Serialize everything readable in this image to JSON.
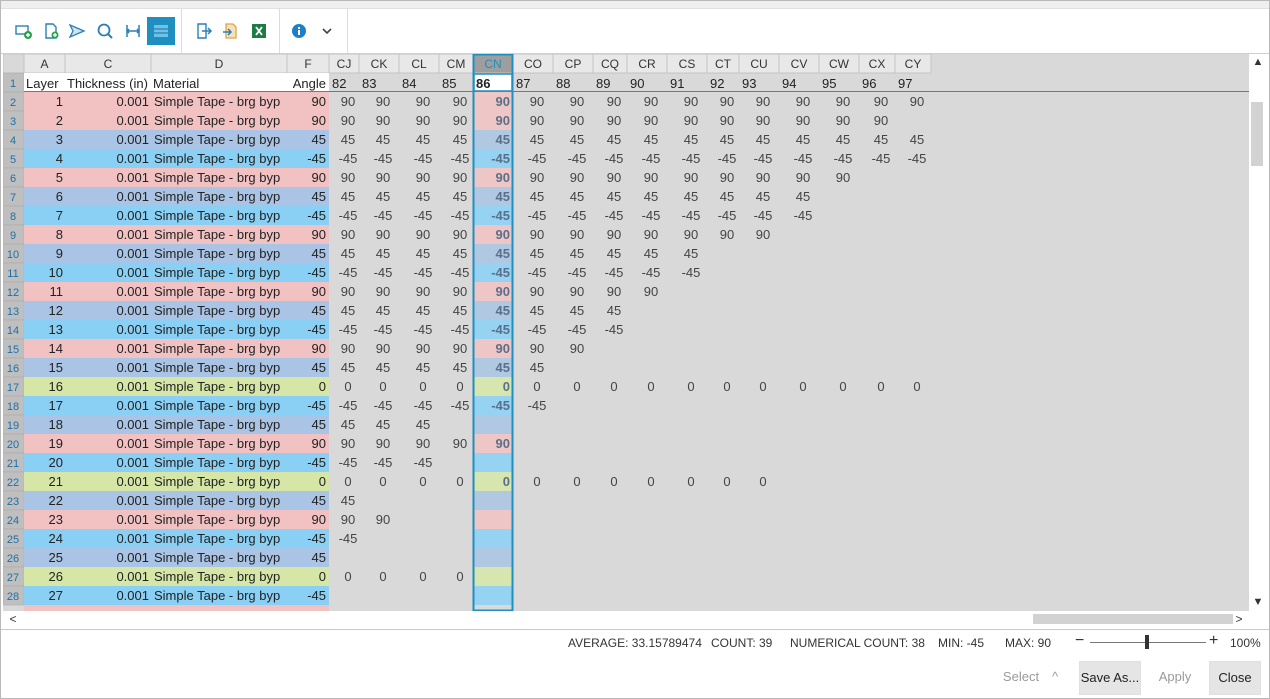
{
  "toolbar": {
    "buttons": [
      {
        "name": "add-row-icon"
      },
      {
        "name": "add-document-icon"
      },
      {
        "name": "send-icon"
      },
      {
        "name": "refresh-search-icon"
      },
      {
        "name": "fit-columns-icon"
      },
      {
        "name": "grid-view-icon"
      },
      {
        "name": "export-icon"
      },
      {
        "name": "import-icon"
      },
      {
        "name": "excel-icon"
      },
      {
        "name": "info-icon"
      },
      {
        "name": "chevron-down-icon"
      }
    ]
  },
  "grid": {
    "selected_column": "CN",
    "left_columns": [
      "A",
      "C",
      "D",
      "F"
    ],
    "left_headers": [
      "Layer",
      "Thickness (in)",
      "Material",
      "Angle"
    ],
    "extra_columns": [
      "CJ",
      "CK",
      "CL",
      "CM",
      "CN",
      "CO",
      "CP",
      "CQ",
      "CR",
      "CS",
      "CT",
      "CU",
      "CV",
      "CW",
      "CX",
      "CY"
    ],
    "extra_header_values": [
      "82",
      "83",
      "84",
      "85",
      "86",
      "87",
      "88",
      "89",
      "90",
      "91",
      "92",
      "93",
      "94",
      "95",
      "96",
      "97"
    ],
    "row_numbers": [
      "1",
      "2",
      "3",
      "4",
      "5",
      "6",
      "7",
      "8",
      "9",
      "10",
      "11",
      "12",
      "13",
      "14",
      "15",
      "16",
      "17",
      "18",
      "19",
      "20",
      "21",
      "22",
      "23",
      "24",
      "25",
      "26",
      "27",
      "28"
    ],
    "rows": [
      {
        "layer": "1",
        "thickness": "0.001",
        "material": "Simple Tape - brg byp",
        "angle": "90",
        "extra": [
          "90",
          "90",
          "90",
          "90",
          "90",
          "90",
          "90",
          "90",
          "90",
          "90",
          "90",
          "90",
          "90",
          "90",
          "90",
          "90"
        ]
      },
      {
        "layer": "2",
        "thickness": "0.001",
        "material": "Simple Tape - brg byp",
        "angle": "90",
        "extra": [
          "90",
          "90",
          "90",
          "90",
          "90",
          "90",
          "90",
          "90",
          "90",
          "90",
          "90",
          "90",
          "90",
          "90",
          "90",
          ""
        ]
      },
      {
        "layer": "3",
        "thickness": "0.001",
        "material": "Simple Tape - brg byp",
        "angle": "45",
        "extra": [
          "45",
          "45",
          "45",
          "45",
          "45",
          "45",
          "45",
          "45",
          "45",
          "45",
          "45",
          "45",
          "45",
          "45",
          "45",
          "45"
        ]
      },
      {
        "layer": "4",
        "thickness": "0.001",
        "material": "Simple Tape - brg byp",
        "angle": "-45",
        "extra": [
          "-45",
          "-45",
          "-45",
          "-45",
          "-45",
          "-45",
          "-45",
          "-45",
          "-45",
          "-45",
          "-45",
          "-45",
          "-45",
          "-45",
          "-45",
          "-45"
        ]
      },
      {
        "layer": "5",
        "thickness": "0.001",
        "material": "Simple Tape - brg byp",
        "angle": "90",
        "extra": [
          "90",
          "90",
          "90",
          "90",
          "90",
          "90",
          "90",
          "90",
          "90",
          "90",
          "90",
          "90",
          "90",
          "90",
          "",
          ""
        ]
      },
      {
        "layer": "6",
        "thickness": "0.001",
        "material": "Simple Tape - brg byp",
        "angle": "45",
        "extra": [
          "45",
          "45",
          "45",
          "45",
          "45",
          "45",
          "45",
          "45",
          "45",
          "45",
          "45",
          "45",
          "45",
          "",
          "",
          ""
        ]
      },
      {
        "layer": "7",
        "thickness": "0.001",
        "material": "Simple Tape - brg byp",
        "angle": "-45",
        "extra": [
          "-45",
          "-45",
          "-45",
          "-45",
          "-45",
          "-45",
          "-45",
          "-45",
          "-45",
          "-45",
          "-45",
          "-45",
          "-45",
          "",
          "",
          ""
        ]
      },
      {
        "layer": "8",
        "thickness": "0.001",
        "material": "Simple Tape - brg byp",
        "angle": "90",
        "extra": [
          "90",
          "90",
          "90",
          "90",
          "90",
          "90",
          "90",
          "90",
          "90",
          "90",
          "90",
          "90",
          "",
          "",
          "",
          ""
        ]
      },
      {
        "layer": "9",
        "thickness": "0.001",
        "material": "Simple Tape - brg byp",
        "angle": "45",
        "extra": [
          "45",
          "45",
          "45",
          "45",
          "45",
          "45",
          "45",
          "45",
          "45",
          "45",
          "",
          "",
          "",
          "",
          "",
          ""
        ]
      },
      {
        "layer": "10",
        "thickness": "0.001",
        "material": "Simple Tape - brg byp",
        "angle": "-45",
        "extra": [
          "-45",
          "-45",
          "-45",
          "-45",
          "-45",
          "-45",
          "-45",
          "-45",
          "-45",
          "-45",
          "",
          "",
          "",
          "",
          "",
          ""
        ]
      },
      {
        "layer": "11",
        "thickness": "0.001",
        "material": "Simple Tape - brg byp",
        "angle": "90",
        "extra": [
          "90",
          "90",
          "90",
          "90",
          "90",
          "90",
          "90",
          "90",
          "90",
          "",
          "",
          "",
          "",
          "",
          "",
          ""
        ]
      },
      {
        "layer": "12",
        "thickness": "0.001",
        "material": "Simple Tape - brg byp",
        "angle": "45",
        "extra": [
          "45",
          "45",
          "45",
          "45",
          "45",
          "45",
          "45",
          "45",
          "",
          "",
          "",
          "",
          "",
          "",
          "",
          ""
        ]
      },
      {
        "layer": "13",
        "thickness": "0.001",
        "material": "Simple Tape - brg byp",
        "angle": "-45",
        "extra": [
          "-45",
          "-45",
          "-45",
          "-45",
          "-45",
          "-45",
          "-45",
          "-45",
          "",
          "",
          "",
          "",
          "",
          "",
          "",
          ""
        ]
      },
      {
        "layer": "14",
        "thickness": "0.001",
        "material": "Simple Tape - brg byp",
        "angle": "90",
        "extra": [
          "90",
          "90",
          "90",
          "90",
          "90",
          "90",
          "90",
          "",
          "",
          "",
          "",
          "",
          "",
          "",
          "",
          ""
        ]
      },
      {
        "layer": "15",
        "thickness": "0.001",
        "material": "Simple Tape - brg byp",
        "angle": "45",
        "extra": [
          "45",
          "45",
          "45",
          "45",
          "45",
          "45",
          "",
          "",
          "",
          "",
          "",
          "",
          "",
          "",
          "",
          ""
        ]
      },
      {
        "layer": "16",
        "thickness": "0.001",
        "material": "Simple Tape - brg byp",
        "angle": "0",
        "extra": [
          "0",
          "0",
          "0",
          "0",
          "0",
          "0",
          "0",
          "0",
          "0",
          "0",
          "0",
          "0",
          "0",
          "0",
          "0",
          "0"
        ]
      },
      {
        "layer": "17",
        "thickness": "0.001",
        "material": "Simple Tape - brg byp",
        "angle": "-45",
        "extra": [
          "-45",
          "-45",
          "-45",
          "-45",
          "-45",
          "-45",
          "",
          "",
          "",
          "",
          "",
          "",
          "",
          "",
          "",
          ""
        ]
      },
      {
        "layer": "18",
        "thickness": "0.001",
        "material": "Simple Tape - brg byp",
        "angle": "45",
        "extra": [
          "45",
          "45",
          "45",
          "",
          "",
          "",
          "",
          "",
          "",
          "",
          "",
          "",
          "",
          "",
          "",
          ""
        ]
      },
      {
        "layer": "19",
        "thickness": "0.001",
        "material": "Simple Tape - brg byp",
        "angle": "90",
        "extra": [
          "90",
          "90",
          "90",
          "90",
          "90",
          "",
          "",
          "",
          "",
          "",
          "",
          "",
          "",
          "",
          "",
          ""
        ]
      },
      {
        "layer": "20",
        "thickness": "0.001",
        "material": "Simple Tape - brg byp",
        "angle": "-45",
        "extra": [
          "-45",
          "-45",
          "-45",
          "",
          "",
          "",
          "",
          "",
          "",
          "",
          "",
          "",
          "",
          "",
          "",
          ""
        ]
      },
      {
        "layer": "21",
        "thickness": "0.001",
        "material": "Simple Tape - brg byp",
        "angle": "0",
        "extra": [
          "0",
          "0",
          "0",
          "0",
          "0",
          "0",
          "0",
          "0",
          "0",
          "0",
          "0",
          "0",
          "",
          "",
          "",
          ""
        ]
      },
      {
        "layer": "22",
        "thickness": "0.001",
        "material": "Simple Tape - brg byp",
        "angle": "45",
        "extra": [
          "45",
          "",
          "",
          "",
          "",
          "",
          "",
          "",
          "",
          "",
          "",
          "",
          "",
          "",
          "",
          ""
        ]
      },
      {
        "layer": "23",
        "thickness": "0.001",
        "material": "Simple Tape - brg byp",
        "angle": "90",
        "extra": [
          "90",
          "90",
          "",
          "",
          "",
          "",
          "",
          "",
          "",
          "",
          "",
          "",
          "",
          "",
          "",
          ""
        ]
      },
      {
        "layer": "24",
        "thickness": "0.001",
        "material": "Simple Tape - brg byp",
        "angle": "-45",
        "extra": [
          "-45",
          "",
          "",
          "",
          "",
          "",
          "",
          "",
          "",
          "",
          "",
          "",
          "",
          "",
          "",
          ""
        ]
      },
      {
        "layer": "25",
        "thickness": "0.001",
        "material": "Simple Tape - brg byp",
        "angle": "45",
        "extra": [
          "",
          "",
          "",
          "",
          "",
          "",
          "",
          "",
          "",
          "",
          "",
          "",
          "",
          "",
          "",
          ""
        ]
      },
      {
        "layer": "26",
        "thickness": "0.001",
        "material": "Simple Tape - brg byp",
        "angle": "0",
        "extra": [
          "0",
          "0",
          "0",
          "0",
          "",
          "",
          "",
          "",
          "",
          "",
          "",
          "",
          "",
          "",
          "",
          ""
        ]
      },
      {
        "layer": "27",
        "thickness": "0.001",
        "material": "Simple Tape - brg byp",
        "angle": "-45",
        "extra": [
          "",
          "",
          "",
          "",
          "",
          "",
          "",
          "",
          "",
          "",
          "",
          "",
          "",
          "",
          "",
          ""
        ]
      }
    ],
    "angle_colors": {
      "90": "#f2c2c2",
      "45": "#a9c4e4",
      "-45": "#8ad0f4",
      "0": "#d6e6a6"
    },
    "selection_color": "#1e8fbf"
  },
  "status": {
    "average": "AVERAGE: 33.15789474",
    "count": "COUNT: 39",
    "numerical_count": "NUMERICAL COUNT: 38",
    "min": "MIN: -45",
    "max": "MAX: 90",
    "zoom_minus": "−",
    "zoom_plus": "+",
    "zoom_level": "100%",
    "zoom_value": 0.5
  },
  "footer": {
    "select_label": "Select",
    "select_chevron": "^",
    "save_as_label": "Save As...",
    "apply_label": "Apply",
    "close_label": "Close"
  },
  "scroll": {
    "up": "▲",
    "down": "▼",
    "left": "<",
    "right": ">"
  }
}
